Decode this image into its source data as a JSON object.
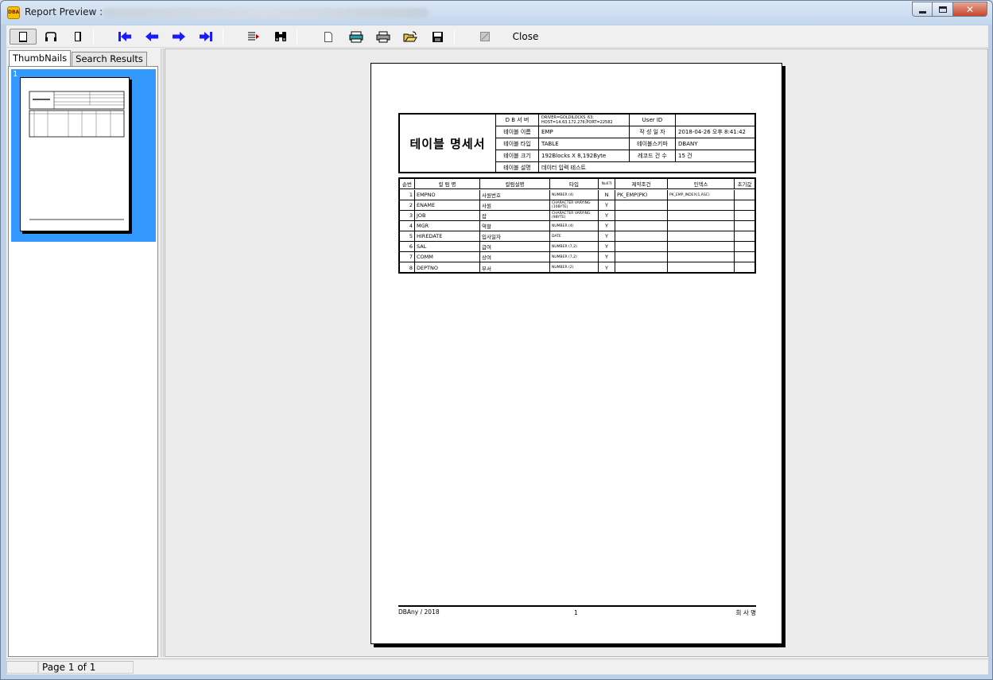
{
  "window": {
    "title": "Report Preview :",
    "app_icon_text": "DBA"
  },
  "toolbar": {
    "close_label": "Close"
  },
  "tabs": [
    {
      "label": "ThumbNails"
    },
    {
      "label": "Search Results"
    }
  ],
  "thumbnail": {
    "page_number": "1"
  },
  "report": {
    "title": "테이블 명세서",
    "header": {
      "row1": {
        "label1": "D B  서 버",
        "value1": "DRIVER=GOLDILOCKS_63; HOST=14.63.172.276;PORT=22582",
        "label2": "User  ID",
        "value2": ""
      },
      "row2": {
        "label1": "테이블 이름",
        "value1": "EMP",
        "label2": "작 성  일 자",
        "value2": "2018-04-26 오후 8:41:42"
      },
      "row3": {
        "label1": "테이블 타입",
        "value1": "TABLE",
        "label2": "테이블스키마",
        "value2": "DBANY"
      },
      "row4": {
        "label1": "테이블 크기",
        "value1": "192Blocks X 8,192Byte",
        "label2": "레코드 건 수",
        "value2": "15 건"
      },
      "row5": {
        "label1": "테이블 설명",
        "value1": "데이터 입력 테스트"
      }
    },
    "columns_header": [
      "순번",
      "컬 럼 명",
      "컬럼설명",
      "타입",
      "Null가",
      "제약조건",
      "인덱스",
      "초기값"
    ],
    "rows": [
      {
        "no": "1",
        "name": "EMPNO",
        "desc": "사원번호",
        "type": "NUMBER (4)",
        "null": "N",
        "constraint": "PK_EMP(PK)",
        "index": "PK_EMP_INDEX(1,ASC)",
        "default": ""
      },
      {
        "no": "2",
        "name": "ENAME",
        "desc": "사원",
        "type": "CHARACTER VARYING (10BYTE)",
        "null": "Y",
        "constraint": "",
        "index": "",
        "default": ""
      },
      {
        "no": "3",
        "name": "JOB",
        "desc": "잡",
        "type": "CHARACTER VARYING (9BYTE)",
        "null": "Y",
        "constraint": "",
        "index": "",
        "default": ""
      },
      {
        "no": "4",
        "name": "MGR",
        "desc": "역할",
        "type": "NUMBER (4)",
        "null": "Y",
        "constraint": "",
        "index": "",
        "default": ""
      },
      {
        "no": "5",
        "name": "HIREDATE",
        "desc": "입사일자",
        "type": "DATE",
        "null": "Y",
        "constraint": "",
        "index": "",
        "default": ""
      },
      {
        "no": "6",
        "name": "SAL",
        "desc": "급여",
        "type": "NUMBER (7,2)",
        "null": "Y",
        "constraint": "",
        "index": "",
        "default": ""
      },
      {
        "no": "7",
        "name": "COMM",
        "desc": "상여",
        "type": "NUMBER (7,2)",
        "null": "Y",
        "constraint": "",
        "index": "",
        "default": ""
      },
      {
        "no": "8",
        "name": "DEPTNO",
        "desc": "부서",
        "type": "NUMBER (2)",
        "null": "Y",
        "constraint": "",
        "index": "",
        "default": ""
      }
    ],
    "footer": {
      "left": "DBAny  /  2018",
      "center": "1",
      "right": "회 사 명"
    }
  },
  "status": {
    "page_text": "Page 1 of 1"
  },
  "icons": [
    "single-page-icon",
    "two-page-icon",
    "page-width-icon",
    "first-page-icon",
    "previous-page-icon",
    "next-page-icon",
    "last-page-icon",
    "go-to-page-icon",
    "find-icon",
    "blank-page-icon",
    "page-setup-icon",
    "print-icon",
    "open-icon",
    "save-icon",
    "disabled-icon"
  ],
  "colors": {
    "thumb_selection": "#3399ff",
    "nav_arrow": "#1a1aff"
  }
}
